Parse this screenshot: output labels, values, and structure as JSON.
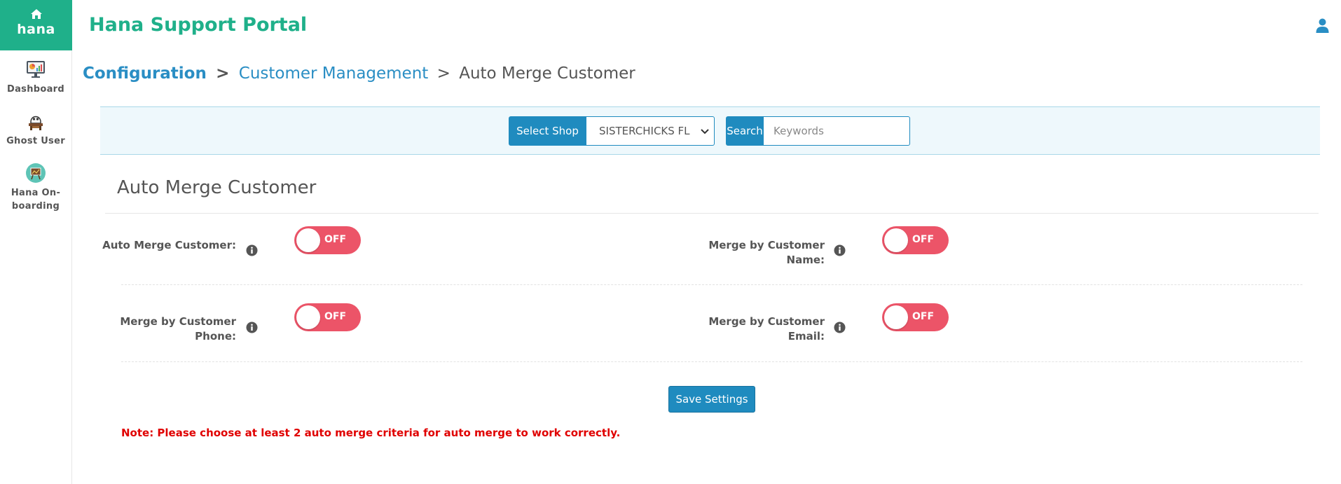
{
  "sidebar": {
    "brand": "hana",
    "items": [
      {
        "label": "Dashboard",
        "icon": "dashboard-monitor-icon"
      },
      {
        "label": "Ghost User",
        "icon": "ghost-user-icon"
      },
      {
        "label": "Hana On-boarding",
        "icon": "onboarding-board-icon"
      }
    ]
  },
  "header": {
    "title": "Hana Support Portal",
    "user_icon": "user-icon"
  },
  "breadcrumb": {
    "root": "Configuration",
    "separator": ">",
    "middle": "Customer Management",
    "current": "Auto Merge Customer"
  },
  "filters": {
    "shop_label": "Select Shop",
    "shop_value": "SISTERCHICKS FL",
    "search_label": "Search",
    "search_placeholder": "Keywords",
    "search_value": ""
  },
  "section": {
    "title": "Auto Merge Customer"
  },
  "settings": [
    {
      "label": "Auto Merge Customer:",
      "state": "OFF"
    },
    {
      "label": "Merge by Customer Name:",
      "state": "OFF"
    },
    {
      "label": "Merge by Customer Phone:",
      "state": "OFF"
    },
    {
      "label": "Merge by Customer Email:",
      "state": "OFF"
    }
  ],
  "actions": {
    "save_label": "Save Settings"
  },
  "note": "Note: Please choose at least 2 auto merge criteria for auto merge to work correctly.",
  "colors": {
    "brand": "#1fb08a",
    "primary": "#1f8bbf",
    "toggle_off": "#ec5468",
    "note": "#e00000"
  }
}
